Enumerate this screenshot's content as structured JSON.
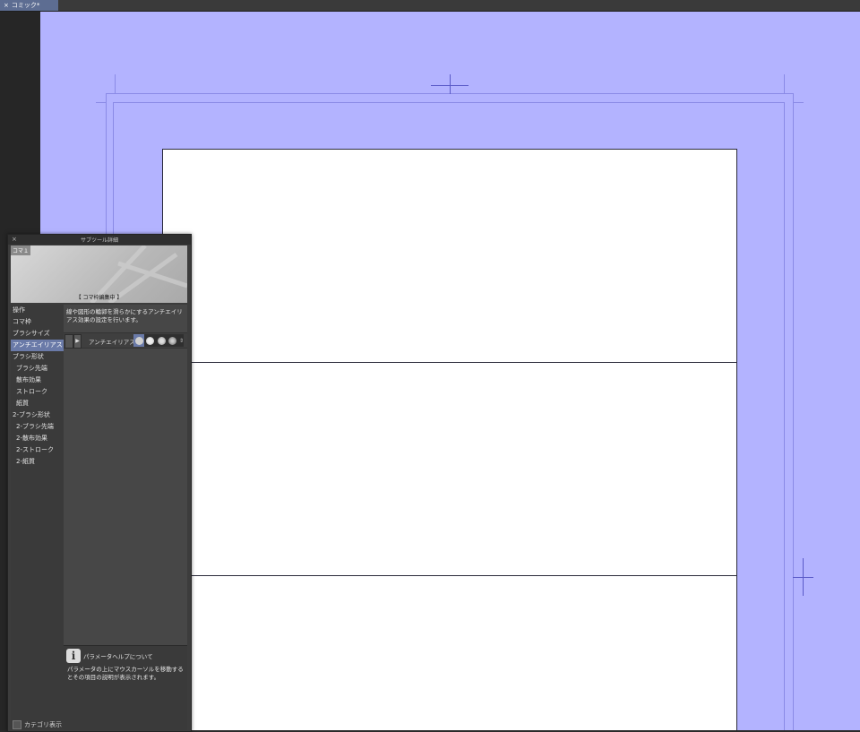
{
  "doc_tab": {
    "close_glyph": "×",
    "title": "コミック*"
  },
  "subtool_panel": {
    "title": "サブツール詳細",
    "close_glyph": "×",
    "preview": {
      "tag": "コマ１",
      "status": "【 コマ枠編集中 】"
    },
    "categories": [
      {
        "label": "操作",
        "sub": false,
        "selected": false
      },
      {
        "label": "コマ枠",
        "sub": false,
        "selected": false
      },
      {
        "label": "ブラシサイズ",
        "sub": false,
        "selected": false
      },
      {
        "label": "アンチエイリアス",
        "sub": false,
        "selected": true
      },
      {
        "label": "ブラシ形状",
        "sub": false,
        "selected": false
      },
      {
        "label": "ブラシ先端",
        "sub": true,
        "selected": false
      },
      {
        "label": "散布効果",
        "sub": true,
        "selected": false
      },
      {
        "label": "ストローク",
        "sub": true,
        "selected": false
      },
      {
        "label": "紙質",
        "sub": true,
        "selected": false
      },
      {
        "label": "2-ブラシ形状",
        "sub": false,
        "selected": false
      },
      {
        "label": "2-ブラシ先端",
        "sub": true,
        "selected": false
      },
      {
        "label": "2-散布効果",
        "sub": true,
        "selected": false
      },
      {
        "label": "2-ストローク",
        "sub": true,
        "selected": false
      },
      {
        "label": "2-紙質",
        "sub": true,
        "selected": false
      }
    ],
    "category_toggle_label": "カテゴリ表示",
    "description": "線や図形の輪郭を滑らかにするアンチエイリアス効果の設定を行います。",
    "antialias": {
      "label": "アンチエイリアス",
      "expand_glyph": "▶",
      "options_count": 4,
      "selected_index": 0
    },
    "help": {
      "title": "パラメータヘルプについて",
      "body": "パラメータの上にマウスカーソルを移動するとその項目の説明が表示されます。"
    }
  },
  "colors": {
    "canvas_bg": "#b3b3ff",
    "accent": "#6a7aa8",
    "guide": "#8a8ae6"
  }
}
